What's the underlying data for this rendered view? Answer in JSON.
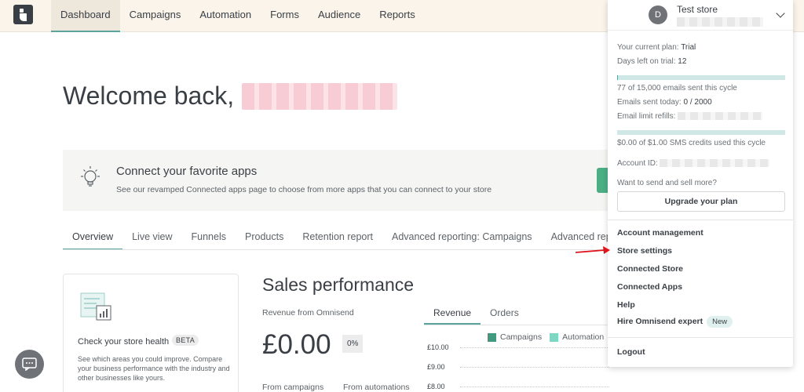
{
  "nav": {
    "items": [
      {
        "label": "Dashboard",
        "active": true
      },
      {
        "label": "Campaigns",
        "active": false
      },
      {
        "label": "Automation",
        "active": false
      },
      {
        "label": "Forms",
        "active": false
      },
      {
        "label": "Audience",
        "active": false
      },
      {
        "label": "Reports",
        "active": false
      }
    ]
  },
  "welcome": {
    "text": "Welcome back,"
  },
  "banner": {
    "title": "Connect your favorite apps",
    "subtitle": "See our revamped Connected apps page to choose from more apps that you can connect to your store",
    "icon": "lightbulb-icon"
  },
  "subtabs": [
    {
      "label": "Overview",
      "active": true
    },
    {
      "label": "Live view",
      "active": false
    },
    {
      "label": "Funnels",
      "active": false
    },
    {
      "label": "Products",
      "active": false
    },
    {
      "label": "Retention report",
      "active": false
    },
    {
      "label": "Advanced reporting: Campaigns",
      "active": false
    },
    {
      "label": "Advanced repor",
      "active": false
    }
  ],
  "health": {
    "title": "Check your store health",
    "badge": "BETA",
    "description": "See which areas you could improve. Compare your business performance with the industry and other businesses like yours."
  },
  "sales": {
    "title": "Sales performance",
    "revenue_label": "Revenue from Omnisend",
    "revenue_value": "£0.00",
    "percent": "0%",
    "from_campaigns": "From campaigns",
    "from_automations": "From automations",
    "tabs": [
      {
        "label": "Revenue",
        "active": true
      },
      {
        "label": "Orders",
        "active": false
      }
    ],
    "legend": [
      {
        "label": "Campaigns",
        "color": "#3f9a80"
      },
      {
        "label": "Automation",
        "color": "#7fd6c2"
      }
    ],
    "yticks": [
      "£10.00",
      "£9.00",
      "£8.00"
    ]
  },
  "account": {
    "avatar_letter": "D",
    "store_name": "Test store",
    "plan_label": "Your current plan:",
    "plan_value": "Trial",
    "days_label": "Days left on trial:",
    "days_value": "12",
    "emails_cycle": "77 of 15,000 emails sent this cycle",
    "emails_fraction": 0.005,
    "emails_today_label": "Emails sent today:",
    "emails_today_value": "0 / 2000",
    "refills_label": "Email limit refills:",
    "sms_cycle": "$0.00 of $1.00 SMS credits used this cycle",
    "sms_fraction": 0,
    "account_id_label": "Account ID:",
    "upsell": "Want to send and sell more?",
    "upgrade_button": "Upgrade your plan",
    "menu": [
      "Account management",
      "Store settings",
      "Connected Store",
      "Connected Apps",
      "Help",
      "Hire Omnisend expert"
    ],
    "new_badge": "New",
    "logout": "Logout"
  },
  "colors": {
    "accent": "#5aa39e",
    "nav_bg": "#faf4ea",
    "annotation_arrow": "#e0141b"
  }
}
